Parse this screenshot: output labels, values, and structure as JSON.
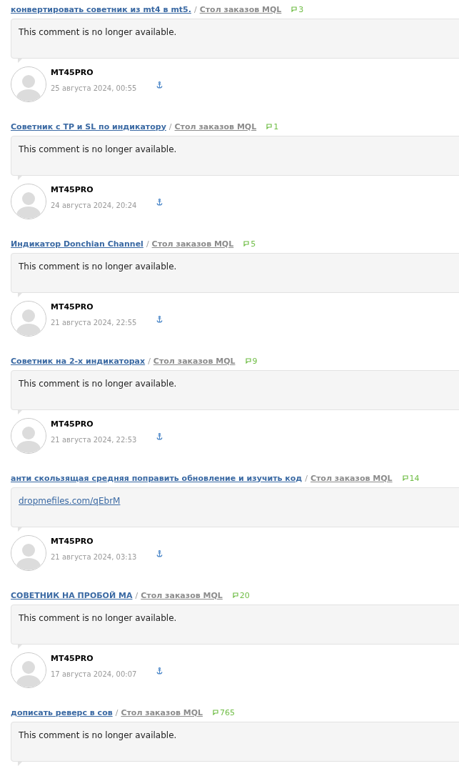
{
  "entries": [
    {
      "topic": "конвертировать советник из mt4 в mt5.",
      "separator": "/",
      "category": "Стол заказов MQL",
      "replies": "3",
      "comment": {
        "kind": "text",
        "text": "This comment is no longer available."
      },
      "author": {
        "name": "MT45PRO",
        "date": "25 августа 2024, 00:55"
      }
    },
    {
      "topic": "Советник с TP и SL по индикатору",
      "separator": "/",
      "category": "Стол заказов MQL",
      "replies": "1",
      "comment": {
        "kind": "text",
        "text": "This comment is no longer available."
      },
      "author": {
        "name": "MT45PRO",
        "date": "24 августа 2024, 20:24"
      }
    },
    {
      "topic": "Индикатор Donchian Channel",
      "separator": "/",
      "category": "Стол заказов MQL",
      "replies": "5",
      "comment": {
        "kind": "text",
        "text": "This comment is no longer available."
      },
      "author": {
        "name": "MT45PRO",
        "date": "21 августа 2024, 22:55"
      }
    },
    {
      "topic": "Советник на 2-х индикаторах",
      "separator": "/",
      "category": "Стол заказов MQL",
      "replies": "9",
      "comment": {
        "kind": "text",
        "text": "This comment is no longer available."
      },
      "author": {
        "name": "MT45PRO",
        "date": "21 августа 2024, 22:53"
      }
    },
    {
      "topic": "анти скользящая средняя поправить обновление и изучить код",
      "separator": "/",
      "category": "Стол заказов MQL",
      "replies": "14",
      "comment": {
        "kind": "link",
        "text": "dropmefiles.com/qEbrM"
      },
      "author": {
        "name": "MT45PRO",
        "date": "21 августа 2024, 03:13"
      }
    },
    {
      "topic": "СОВЕТНИК НА ПРОБОЙ МА",
      "separator": "/",
      "category": "Стол заказов MQL",
      "replies": "20",
      "comment": {
        "kind": "text",
        "text": "This comment is no longer available."
      },
      "author": {
        "name": "MT45PRO",
        "date": "17 августа 2024, 00:07"
      }
    },
    {
      "topic": "дописать реверс в сов",
      "separator": "/",
      "category": "Стол заказов MQL",
      "replies": "765",
      "comment": {
        "kind": "text",
        "text": "This comment is no longer available."
      }
    }
  ]
}
